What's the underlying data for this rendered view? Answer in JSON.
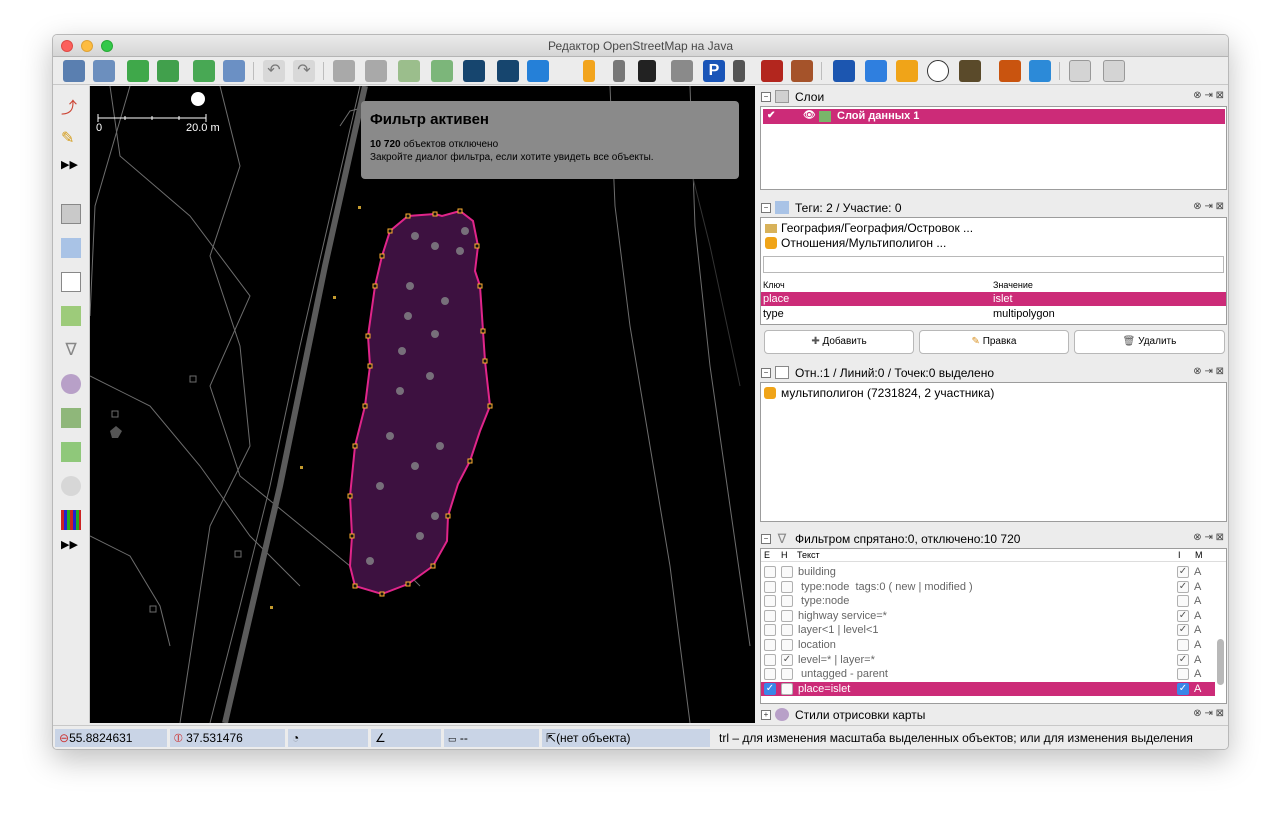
{
  "window": {
    "title": "Редактор OpenStreetMap на Java"
  },
  "map": {
    "scale_start": "0",
    "scale_end": "20.0 m",
    "banner_title": "Фильтр активен",
    "banner_count": "10 720",
    "banner_count_suffix": "объектов отключено",
    "banner_hint": "Закройте диалог фильтра, если хотите увидеть все объекты."
  },
  "layers_panel": {
    "title": "Слои",
    "layer_name": "Слой данных 1"
  },
  "tags_panel": {
    "title": "Теги: 2 / Участие: 0",
    "preset1": "География/География/Островок ...",
    "preset2": "Отношения/Мультиполигон ...",
    "col_key": "Ключ",
    "col_value": "Значение",
    "rows": [
      {
        "key": "place",
        "value": "islet"
      },
      {
        "key": "type",
        "value": "multipolygon"
      }
    ],
    "add_label": "Добавить",
    "edit_label": "Правка",
    "delete_label": "Удалить"
  },
  "selection_panel": {
    "title": "Отн.:1 / Линий:0 / Точек:0 выделено",
    "item": "мультиполигон (7231824, 2 участника)"
  },
  "filter_panel": {
    "title": "Фильтром спрятано:0, отключено:10 720",
    "col_e": "E",
    "col_h": "H",
    "col_text": "Текст",
    "col_i": "I",
    "col_m": "M",
    "rows": [
      {
        "text": "building",
        "h": false,
        "e": false,
        "i": true,
        "m": "A"
      },
      {
        "text": " type:node  tags:0 ( new | modified )",
        "h": false,
        "e": false,
        "i": true,
        "m": "A"
      },
      {
        "text": " type:node",
        "h": false,
        "e": false,
        "i": false,
        "m": "A"
      },
      {
        "text": "highway service=*",
        "h": false,
        "e": false,
        "i": true,
        "m": "A"
      },
      {
        "text": "layer<1 | level<1",
        "h": false,
        "e": false,
        "i": true,
        "m": "A"
      },
      {
        "text": "location",
        "h": false,
        "e": false,
        "i": false,
        "m": "A"
      },
      {
        "text": "level=* | layer=*",
        "h": true,
        "e": false,
        "i": true,
        "m": "A"
      },
      {
        "text": " untagged - parent",
        "h": false,
        "e": false,
        "i": false,
        "m": "A"
      },
      {
        "text": "place=islet",
        "h": false,
        "e": true,
        "i": true,
        "m": "A"
      }
    ]
  },
  "styles_panel": {
    "title": "Стили отрисовки карты"
  },
  "statusbar": {
    "lat": "55.8824631",
    "lon": "37.531476",
    "dist": "--",
    "object": "(нет объекта)",
    "hint": "trl – для изменения масштаба выделенных объектов; или для изменения выделения"
  },
  "colors": {
    "accent": "#cc2b78",
    "island_fill": "#3a1238",
    "island_outline": "#e8208a",
    "node": "#ffb030"
  }
}
